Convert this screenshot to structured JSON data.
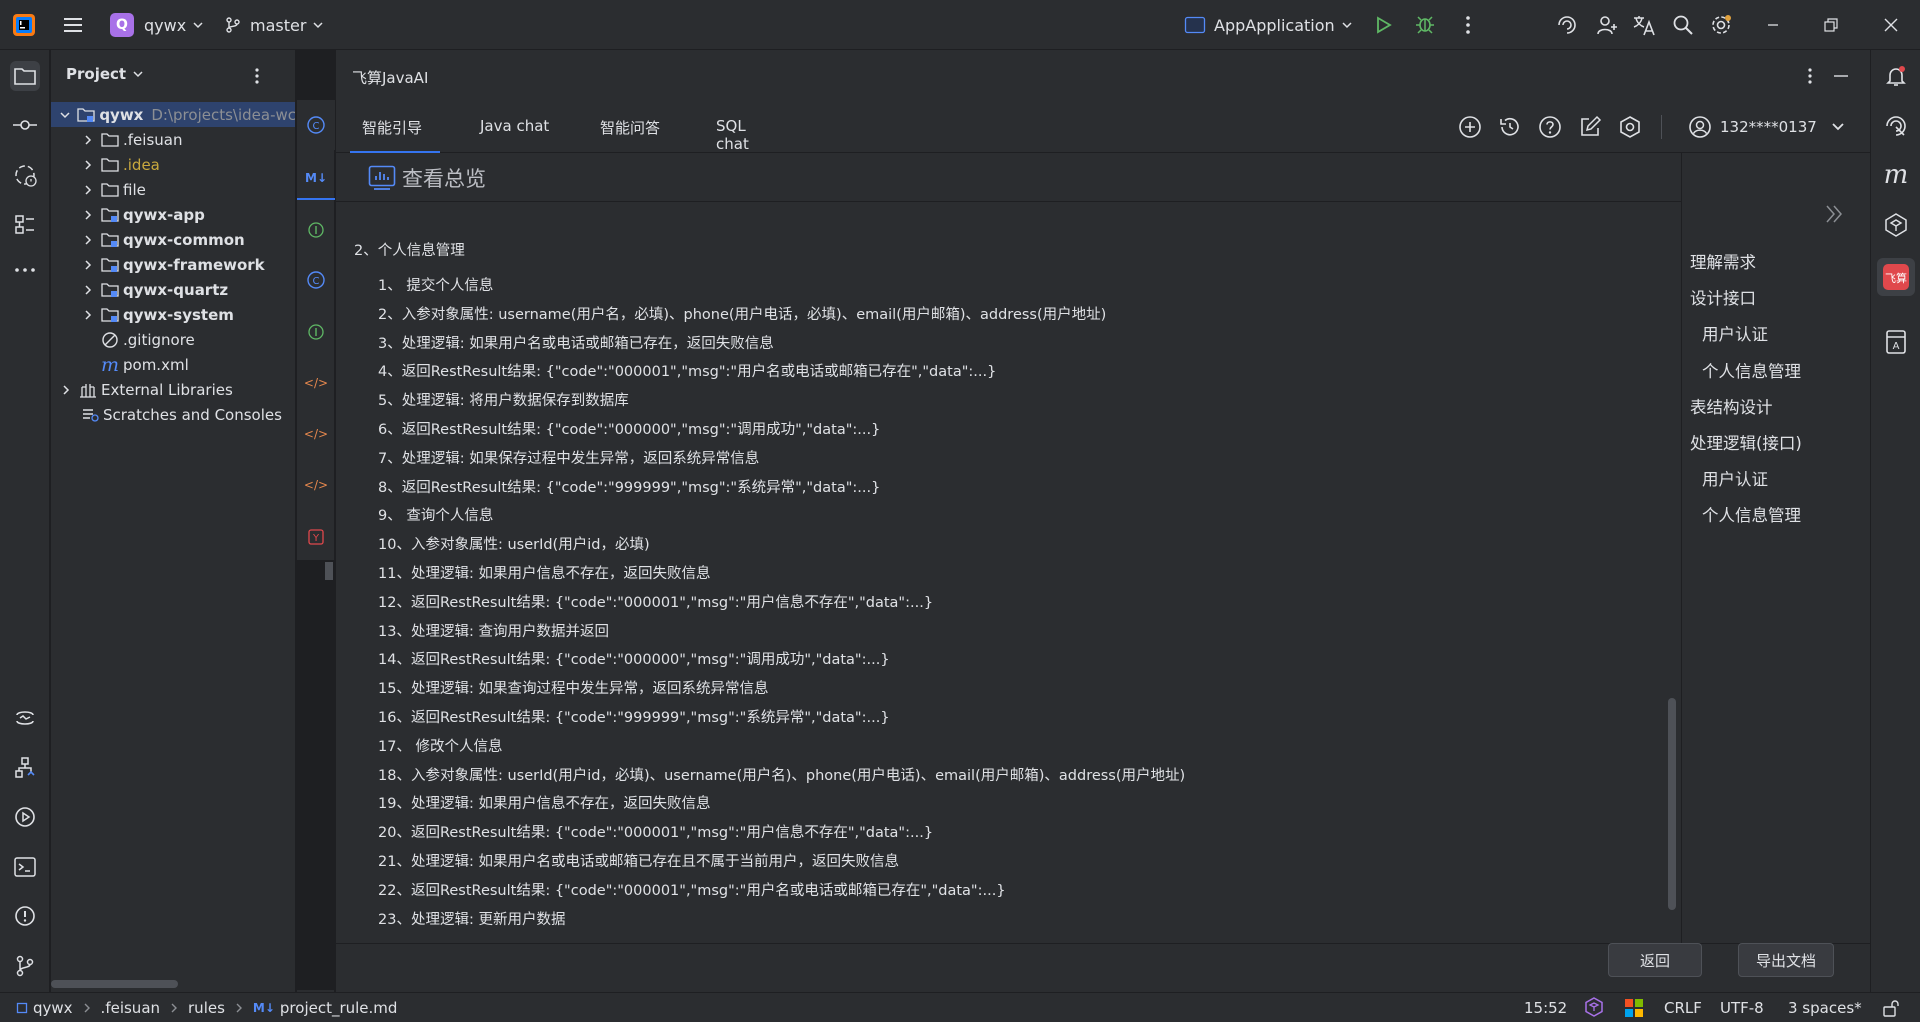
{
  "titlebar": {
    "project_badge": "Q",
    "project_name": "qywx",
    "branch": "master",
    "run_config": "AppApplication"
  },
  "project_panel": {
    "title": "Project",
    "tree": [
      {
        "label": "qywx",
        "path": "D:\\projects\\idea-wc",
        "type": "module-root"
      },
      {
        "label": ".feisuan",
        "type": "folder"
      },
      {
        "label": ".idea",
        "type": "folder-excluded"
      },
      {
        "label": "file",
        "type": "folder"
      },
      {
        "label": "qywx-app",
        "type": "module"
      },
      {
        "label": "qywx-common",
        "type": "module"
      },
      {
        "label": "qywx-framework",
        "type": "module"
      },
      {
        "label": "qywx-quartz",
        "type": "module"
      },
      {
        "label": "qywx-system",
        "type": "module"
      },
      {
        "label": ".gitignore",
        "type": "gitignore"
      },
      {
        "label": "pom.xml",
        "type": "maven"
      },
      {
        "label": "External Libraries",
        "type": "library"
      },
      {
        "label": "Scratches and Consoles",
        "type": "scratches"
      }
    ]
  },
  "ai_panel": {
    "title": "飞算JavaAI",
    "tabs": [
      "智能引导",
      "Java chat",
      "智能问答",
      "SQL chat"
    ],
    "active_tab": 0,
    "user": "132****0137",
    "section_title": "查看总览",
    "heading": "2、个人信息管理",
    "lines": [
      "1、 提交个人信息",
      "2、入参对象属性: username(用户名，必填)、phone(用户电话，必填)、email(用户邮箱)、address(用户地址)",
      "3、处理逻辑: 如果用户名或电话或邮箱已存在，返回失败信息",
      "4、返回RestResult结果: {\"code\":\"000001\",\"msg\":\"用户名或电话或邮箱已存在\",\"data\":...}",
      "5、处理逻辑: 将用户数据保存到数据库",
      "6、返回RestResult结果: {\"code\":\"000000\",\"msg\":\"调用成功\",\"data\":...}",
      "7、处理逻辑: 如果保存过程中发生异常，返回系统异常信息",
      "8、返回RestResult结果: {\"code\":\"999999\",\"msg\":\"系统异常\",\"data\":...}",
      "9、 查询个人信息",
      "10、入参对象属性: userId(用户id，必填)",
      "11、处理逻辑: 如果用户信息不存在，返回失败信息",
      "12、返回RestResult结果: {\"code\":\"000001\",\"msg\":\"用户信息不存在\",\"data\":...}",
      "13、处理逻辑: 查询用户数据并返回",
      "14、返回RestResult结果: {\"code\":\"000000\",\"msg\":\"调用成功\",\"data\":...}",
      "15、处理逻辑: 如果查询过程中发生异常，返回系统异常信息",
      "16、返回RestResult结果: {\"code\":\"999999\",\"msg\":\"系统异常\",\"data\":...}",
      "17、 修改个人信息",
      "18、入参对象属性: userId(用户id，必填)、username(用户名)、phone(用户电话)、email(用户邮箱)、address(用户地址)",
      "19、处理逻辑: 如果用户信息不存在，返回失败信息",
      "20、返回RestResult结果: {\"code\":\"000001\",\"msg\":\"用户信息不存在\",\"data\":...}",
      "21、处理逻辑: 如果用户名或电话或邮箱已存在且不属于当前用户，返回失败信息",
      "22、返回RestResult结果: {\"code\":\"000001\",\"msg\":\"用户名或电话或邮箱已存在\",\"data\":...}",
      "23、处理逻辑: 更新用户数据"
    ],
    "toc": [
      {
        "label": "理解需求",
        "level": 0
      },
      {
        "label": "设计接口",
        "level": 0
      },
      {
        "label": "用户认证",
        "level": 1
      },
      {
        "label": "个人信息管理",
        "level": 1
      },
      {
        "label": "表结构设计",
        "level": 0
      },
      {
        "label": "处理逻辑(接口)",
        "level": 0
      },
      {
        "label": "用户认证",
        "level": 1
      },
      {
        "label": "个人信息管理",
        "level": 1
      }
    ],
    "back_button": "返回",
    "export_button": "导出文档"
  },
  "statusbar": {
    "breadcrumb": [
      "qywx",
      ".feisuan",
      "rules",
      "project_rule.md"
    ],
    "time": "15:52",
    "line_sep": "CRLF",
    "encoding": "UTF-8",
    "indent": "3 spaces*"
  },
  "colors": {
    "bg": "#2b2d30",
    "bg_dark": "#1e1f22",
    "text": "#dfe1e5",
    "accent": "#3574f0",
    "project_badge": "#a871e8",
    "run_green": "#5fb865",
    "feisuan_red": "#e0484c",
    "excluded": "#c9a93e"
  }
}
